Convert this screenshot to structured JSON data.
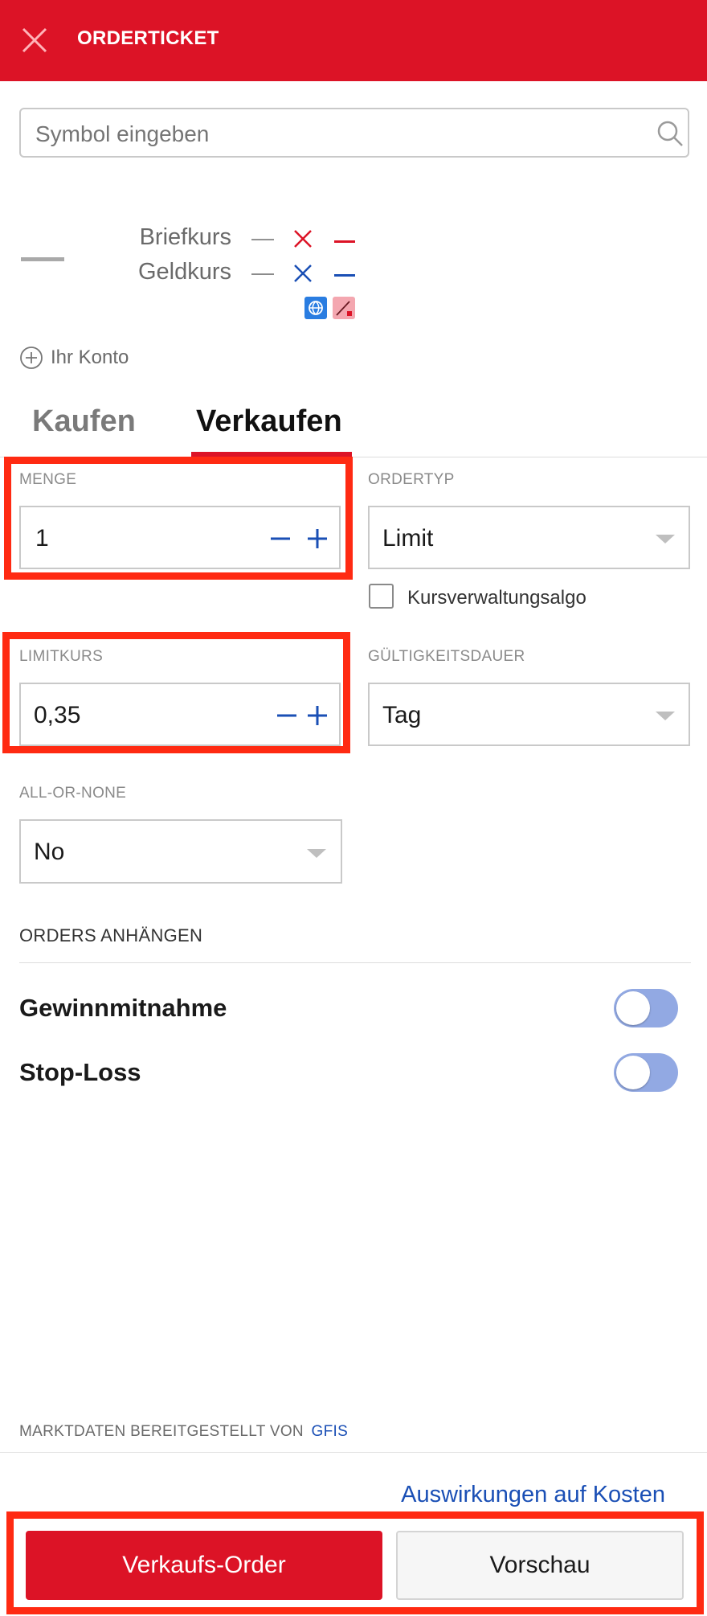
{
  "header": {
    "title": "ORDERTICKET"
  },
  "search": {
    "placeholder": "Symbol eingeben"
  },
  "quote": {
    "ask_label": "Briefkurs",
    "bid_label": "Geldkurs",
    "ask_values": [
      "—",
      "—"
    ],
    "bid_values": [
      "—",
      "—"
    ]
  },
  "account": {
    "label": "Ihr Konto"
  },
  "tabs": [
    {
      "label": "Kaufen",
      "active": false
    },
    {
      "label": "Verkaufen",
      "active": true
    }
  ],
  "form": {
    "quantity": {
      "label": "MENGE",
      "value": "1"
    },
    "order_type": {
      "label": "ORDERTYP",
      "value": "Limit"
    },
    "algo_checkbox": {
      "label": "Kursverwaltungsalgo",
      "checked": false
    },
    "limit_price": {
      "label": "LIMITKURS",
      "value": "0,35"
    },
    "validity": {
      "label": "GÜLTIGKEITSDAUER",
      "value": "Tag"
    },
    "all_or_none": {
      "label": "ALL-OR-NONE",
      "value": "No"
    }
  },
  "attach_orders": {
    "heading": "ORDERS ANHÄNGEN",
    "take_profit": {
      "label": "Gewinnmitnahme",
      "on": false
    },
    "stop_loss": {
      "label": "Stop-Loss",
      "on": false
    }
  },
  "footer": {
    "market_data_prefix": "MARKTDATEN BEREITGESTELLT VON",
    "market_data_provider": "GFIS",
    "cost_link": "Auswirkungen auf Kosten",
    "submit_button": "Verkaufs-Order",
    "preview_button": "Vorschau"
  },
  "colors": {
    "brand_red": "#dc1326",
    "link_blue": "#1a4fb5",
    "highlight_frame": "#ff2a12",
    "toggle_off": "#92a9e3"
  },
  "icons": [
    "close-icon",
    "search-icon",
    "plus-circle-icon",
    "minus-icon",
    "plus-icon",
    "chevron-down-icon",
    "globe-icon",
    "chart-badge-icon"
  ]
}
